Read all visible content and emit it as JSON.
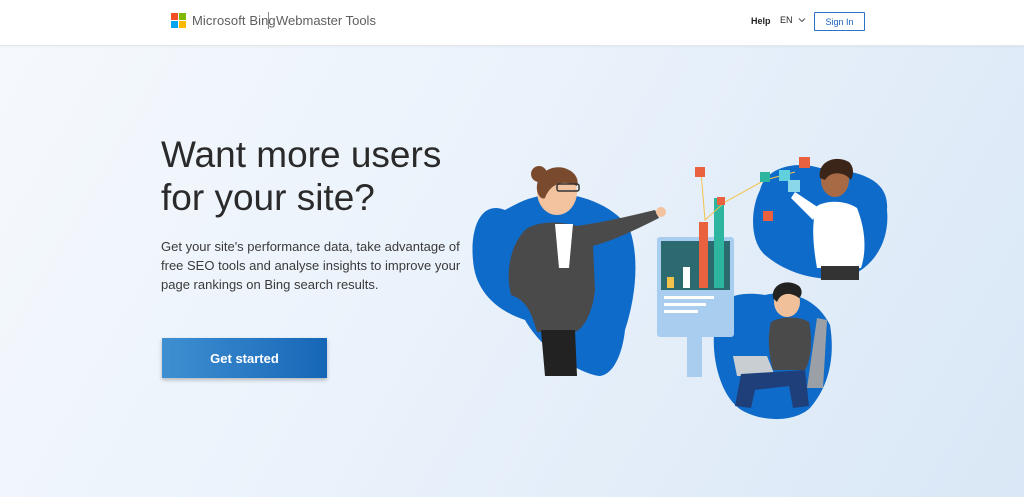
{
  "header": {
    "brand": "Microsoft Bing",
    "product": "Webmaster Tools",
    "help": "Help",
    "language": "EN",
    "signin": "Sign In"
  },
  "hero": {
    "headline_line1": "Want more users",
    "headline_line2": "for your site?",
    "description": "Get your site's performance data, take advantage of free SEO tools and analyse insights to improve your page rankings on Bing search results.",
    "cta": "Get started"
  },
  "colors": {
    "brand_blue": "#1666b7",
    "logo_red": "#f25022",
    "logo_green": "#7fba00",
    "logo_blue": "#00a4ef",
    "logo_yellow": "#ffb900",
    "illustration_blue": "#0f6bc9"
  },
  "icons": {
    "logo": "microsoft-logo-icon",
    "language_chevron": "chevron-down-icon"
  }
}
